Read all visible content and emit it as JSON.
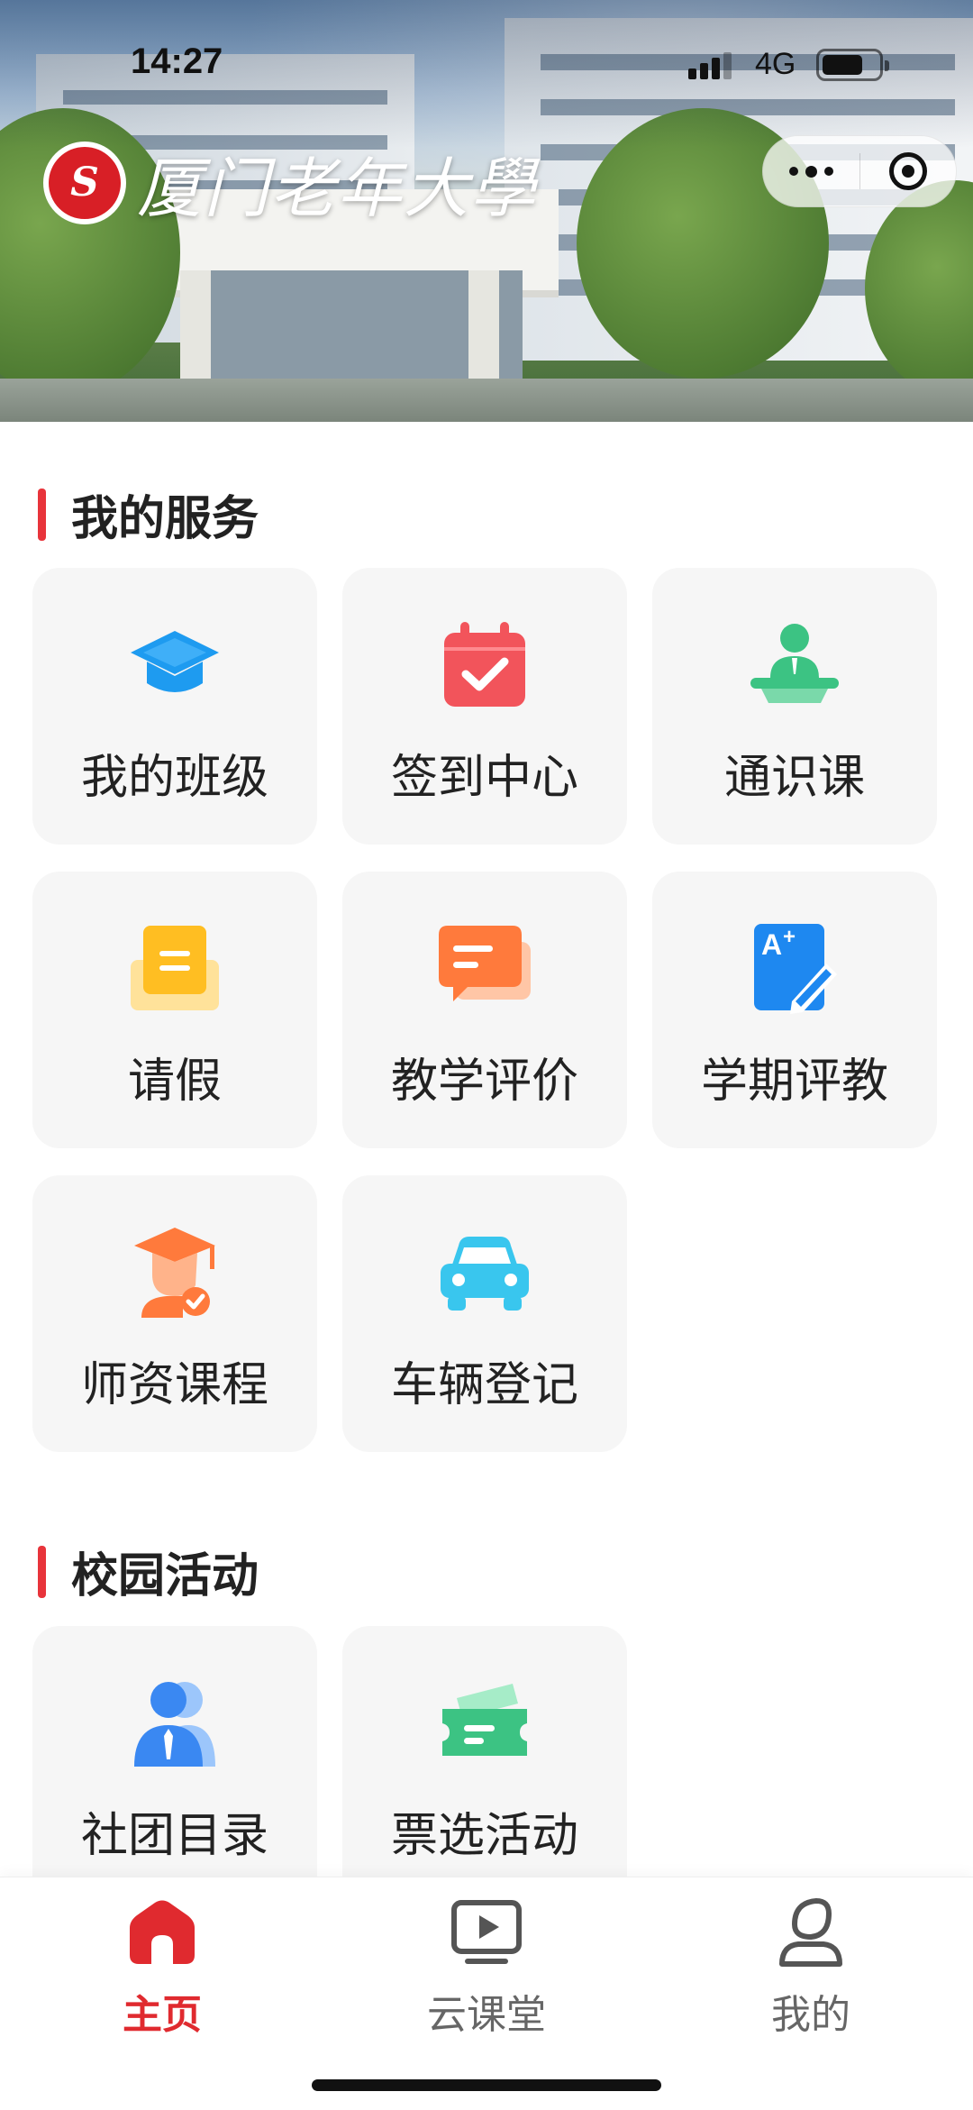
{
  "status_bar": {
    "time": "14:27",
    "network": "4G"
  },
  "header": {
    "school_name": "厦门老年大學",
    "emblem_text": "S"
  },
  "sections": [
    {
      "title": "我的服务",
      "items": [
        {
          "label": "我的班级",
          "icon": "graduation-cap-icon",
          "color": "#1e9bf0"
        },
        {
          "label": "签到中心",
          "icon": "calendar-check-icon",
          "color": "#f2545b"
        },
        {
          "label": "通识课",
          "icon": "lecturer-podium-icon",
          "color": "#3cc383"
        },
        {
          "label": "请假",
          "icon": "leave-envelope-icon",
          "color": "#ffbe22"
        },
        {
          "label": "教学评价",
          "icon": "chat-bubbles-icon",
          "color": "#ff7a3c"
        },
        {
          "label": "学期评教",
          "icon": "grade-a-plus-icon",
          "color": "#1e88f0"
        },
        {
          "label": "师资课程",
          "icon": "teacher-badge-icon",
          "color": "#ff7a3c"
        },
        {
          "label": "车辆登记",
          "icon": "car-icon",
          "color": "#39c6ee"
        }
      ]
    },
    {
      "title": "校园活动",
      "items": [
        {
          "label": "社团目录",
          "icon": "club-members-icon",
          "color": "#3a88f2"
        },
        {
          "label": "票选活动",
          "icon": "ticket-icon",
          "color": "#3cc383"
        }
      ]
    }
  ],
  "tabbar": [
    {
      "label": "主页",
      "icon": "home-icon",
      "active": true,
      "color": "#e02a2f"
    },
    {
      "label": "云课堂",
      "icon": "video-play-icon",
      "active": false,
      "color": "#555555"
    },
    {
      "label": "我的",
      "icon": "user-profile-icon",
      "active": false,
      "color": "#555555"
    }
  ]
}
